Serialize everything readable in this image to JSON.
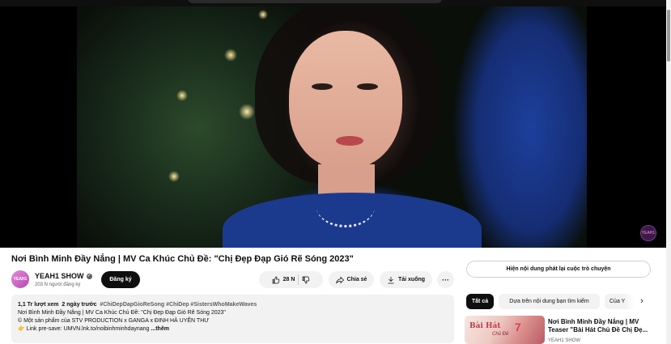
{
  "video": {
    "title": "Nơi Bình Minh Đầy Nắng | MV Ca Khúc Chủ Đề: \"Chị Đẹp Đạp Gió Rẽ Sóng 2023\"",
    "watermark": "YEAH1"
  },
  "channel": {
    "avatar_text": "YEAH1",
    "name": "YEAH1 SHOW",
    "verified_icon": "✓",
    "subscribers": "203 N người đăng ký",
    "subscribe_label": "Đăng ký"
  },
  "actions": {
    "like_count": "28 N",
    "share_label": "Chia sẻ",
    "download_label": "Tải xuống",
    "more_label": "···",
    "icons": [
      "thumbs-up-icon",
      "thumbs-down-icon",
      "share-icon",
      "download-icon",
      "more-icon"
    ]
  },
  "description": {
    "views": "1,1 Tr lượt xem",
    "date": "2 ngày trước",
    "hashtags": "#ChiDepDapGioReSong #ChiDep #SistersWhoMakeWaves",
    "line1": "Nơi Bình Minh Đầy Nắng | MV Ca Khúc Chủ Đề: \"Chị Đẹp Đạp Gió Rẽ Sóng 2023\"",
    "line2": "© Một sản phẩm của STV PRODUCTION x GANGA x ĐINH HÀ UYÊN THƯ",
    "line3_emoji": "👉",
    "line3": "Link pre-save: UMVN.lnk.to/noibinhminhdaynang",
    "more_label": "...thêm"
  },
  "sidebar": {
    "chat_replay_label": "Hiện nội dung phát lại cuộc trò chuyện",
    "chips": [
      "Tất cả",
      "Dựa trên nội dung bạn tìm kiếm",
      "Của Y"
    ],
    "next_arrow": "›",
    "recommendation": {
      "thumb_text": "Bài Hát",
      "thumb_subtext": "Chủ Đề",
      "title": "Nơi Bình Minh Đầy Nắng | MV Teaser \"Bài Hát Chủ Đề Chị Đẹ...",
      "channel": "YEAH1 SHOW"
    }
  },
  "colors": {
    "subscribe_bg": "#0f0f0f",
    "pill_bg": "#f2f2f2",
    "secondary_text": "#606060"
  }
}
